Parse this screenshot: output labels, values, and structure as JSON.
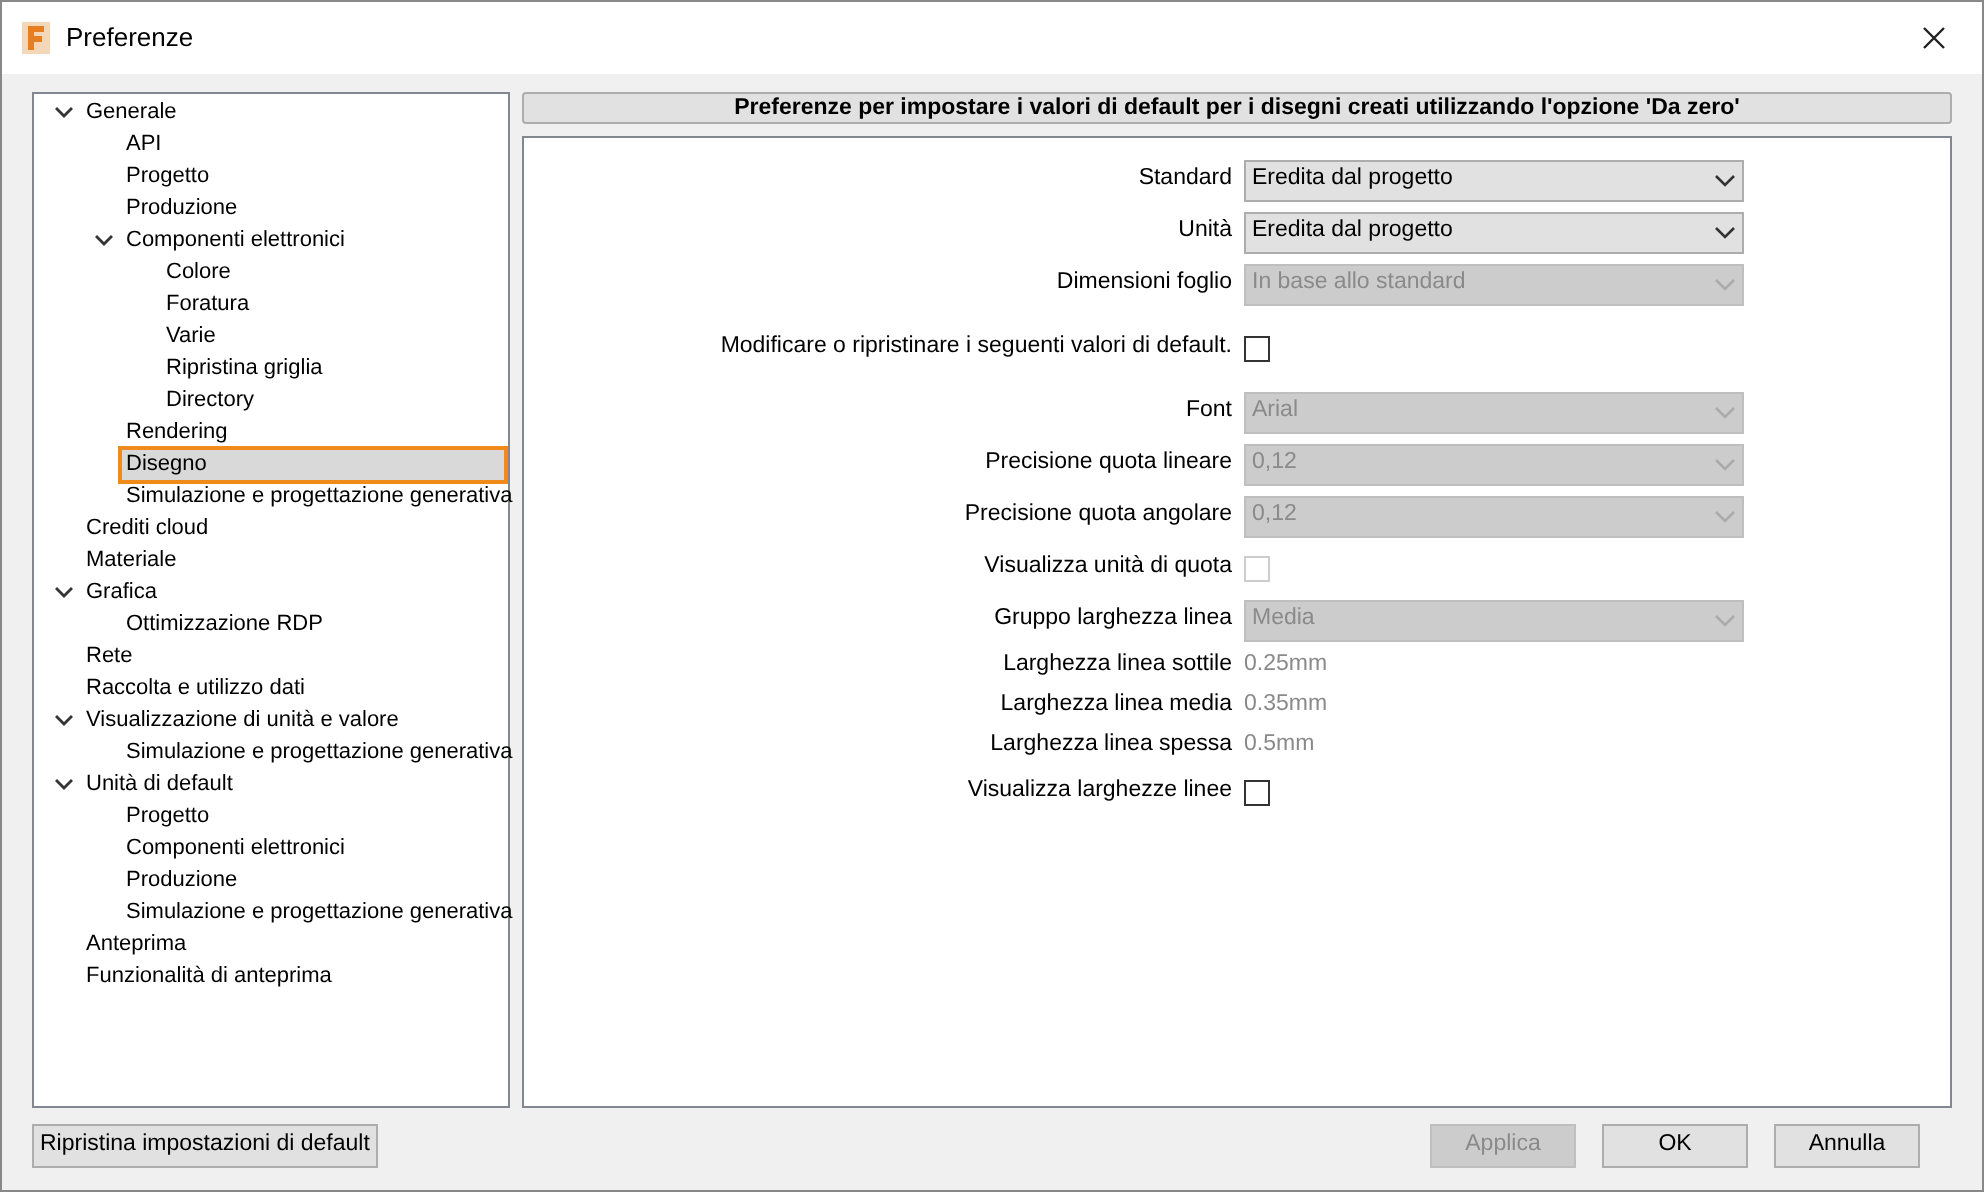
{
  "window": {
    "title": "Preferenze"
  },
  "tree": [
    {
      "label": "Generale",
      "expanded": true,
      "selected": false,
      "children": [
        {
          "label": "API",
          "selected": false
        },
        {
          "label": "Progetto",
          "selected": false
        },
        {
          "label": "Produzione",
          "selected": false
        },
        {
          "label": "Componenti elettronici",
          "expanded": true,
          "selected": false,
          "children": [
            {
              "label": "Colore",
              "selected": false
            },
            {
              "label": "Foratura",
              "selected": false
            },
            {
              "label": "Varie",
              "selected": false
            },
            {
              "label": "Ripristina griglia",
              "selected": false
            },
            {
              "label": "Directory",
              "selected": false
            }
          ]
        },
        {
          "label": "Rendering",
          "selected": false
        },
        {
          "label": "Disegno",
          "selected": true
        },
        {
          "label": "Simulazione e progettazione generativa",
          "selected": false
        }
      ]
    },
    {
      "label": "Crediti cloud",
      "selected": false
    },
    {
      "label": "Materiale",
      "selected": false
    },
    {
      "label": "Grafica",
      "expanded": true,
      "selected": false,
      "children": [
        {
          "label": "Ottimizzazione RDP",
          "selected": false
        }
      ]
    },
    {
      "label": "Rete",
      "selected": false
    },
    {
      "label": "Raccolta e utilizzo dati",
      "selected": false
    },
    {
      "label": "Visualizzazione di unità e valore",
      "expanded": true,
      "selected": false,
      "children": [
        {
          "label": "Simulazione e progettazione generativa",
          "selected": false
        }
      ]
    },
    {
      "label": "Unità di default",
      "expanded": true,
      "selected": false,
      "children": [
        {
          "label": "Progetto",
          "selected": false
        },
        {
          "label": "Componenti elettronici",
          "selected": false
        },
        {
          "label": "Produzione",
          "selected": false
        },
        {
          "label": "Simulazione e progettazione generativa",
          "selected": false
        }
      ]
    },
    {
      "label": "Anteprima",
      "selected": false
    },
    {
      "label": "Funzionalità di anteprima",
      "selected": false
    }
  ],
  "reset_button": "Ripristina impostazioni di default",
  "header": "Preferenze per impostare i valori di default per i disegni creati utilizzando l'opzione 'Da zero'",
  "fields": [
    {
      "kind": "select",
      "label": "Standard",
      "value": "Eredita dal progetto",
      "disabled": false
    },
    {
      "kind": "select",
      "label": "Unità",
      "value": "Eredita dal progetto",
      "disabled": false
    },
    {
      "kind": "select",
      "label": "Dimensioni foglio",
      "value": "In base allo standard",
      "disabled": true
    },
    {
      "kind": "checkbox",
      "label": "Modificare o ripristinare i seguenti valori di default.",
      "checked": false,
      "disabled": false
    },
    {
      "kind": "select",
      "label": "Font",
      "value": "Arial",
      "disabled": true
    },
    {
      "kind": "select",
      "label": "Precisione quota lineare",
      "value": "0,12",
      "disabled": true
    },
    {
      "kind": "select",
      "label": "Precisione quota angolare",
      "value": "0,12",
      "disabled": true
    },
    {
      "kind": "checkbox",
      "label": "Visualizza unità di quota",
      "checked": false,
      "disabled": true
    },
    {
      "kind": "select",
      "label": "Gruppo larghezza linea",
      "value": "Media",
      "disabled": true
    },
    {
      "kind": "text",
      "label": "Larghezza linea sottile",
      "value": "0.25mm"
    },
    {
      "kind": "text",
      "label": "Larghezza linea media",
      "value": "0.35mm"
    },
    {
      "kind": "text",
      "label": "Larghezza linea spessa",
      "value": "0.5mm"
    },
    {
      "kind": "checkbox",
      "label": "Visualizza larghezze linee",
      "checked": false,
      "disabled": false
    }
  ],
  "buttons": [
    {
      "label": "Applica",
      "disabled": true
    },
    {
      "label": "OK",
      "disabled": false
    },
    {
      "label": "Annulla",
      "disabled": false
    }
  ]
}
